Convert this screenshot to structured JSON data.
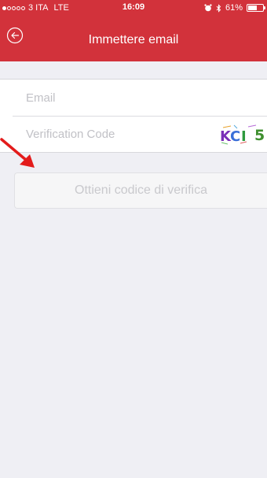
{
  "status_bar": {
    "carrier": "3 ITA",
    "network": "LTE",
    "time": "16:09",
    "battery_percent": "61%",
    "battery_level": 0.61
  },
  "nav": {
    "title": "Immettere email",
    "back_icon": "back-arrow-circle-icon"
  },
  "form": {
    "email_placeholder": "Email",
    "email_value": "",
    "code_placeholder": "Verification Code",
    "code_value": "",
    "captcha_text": "KCI 5"
  },
  "actions": {
    "get_code_label": "Ottieni codice di verifica"
  },
  "colors": {
    "brand_red": "#d2323b",
    "background": "#efeff4",
    "annotation_arrow": "#e31b1b"
  }
}
